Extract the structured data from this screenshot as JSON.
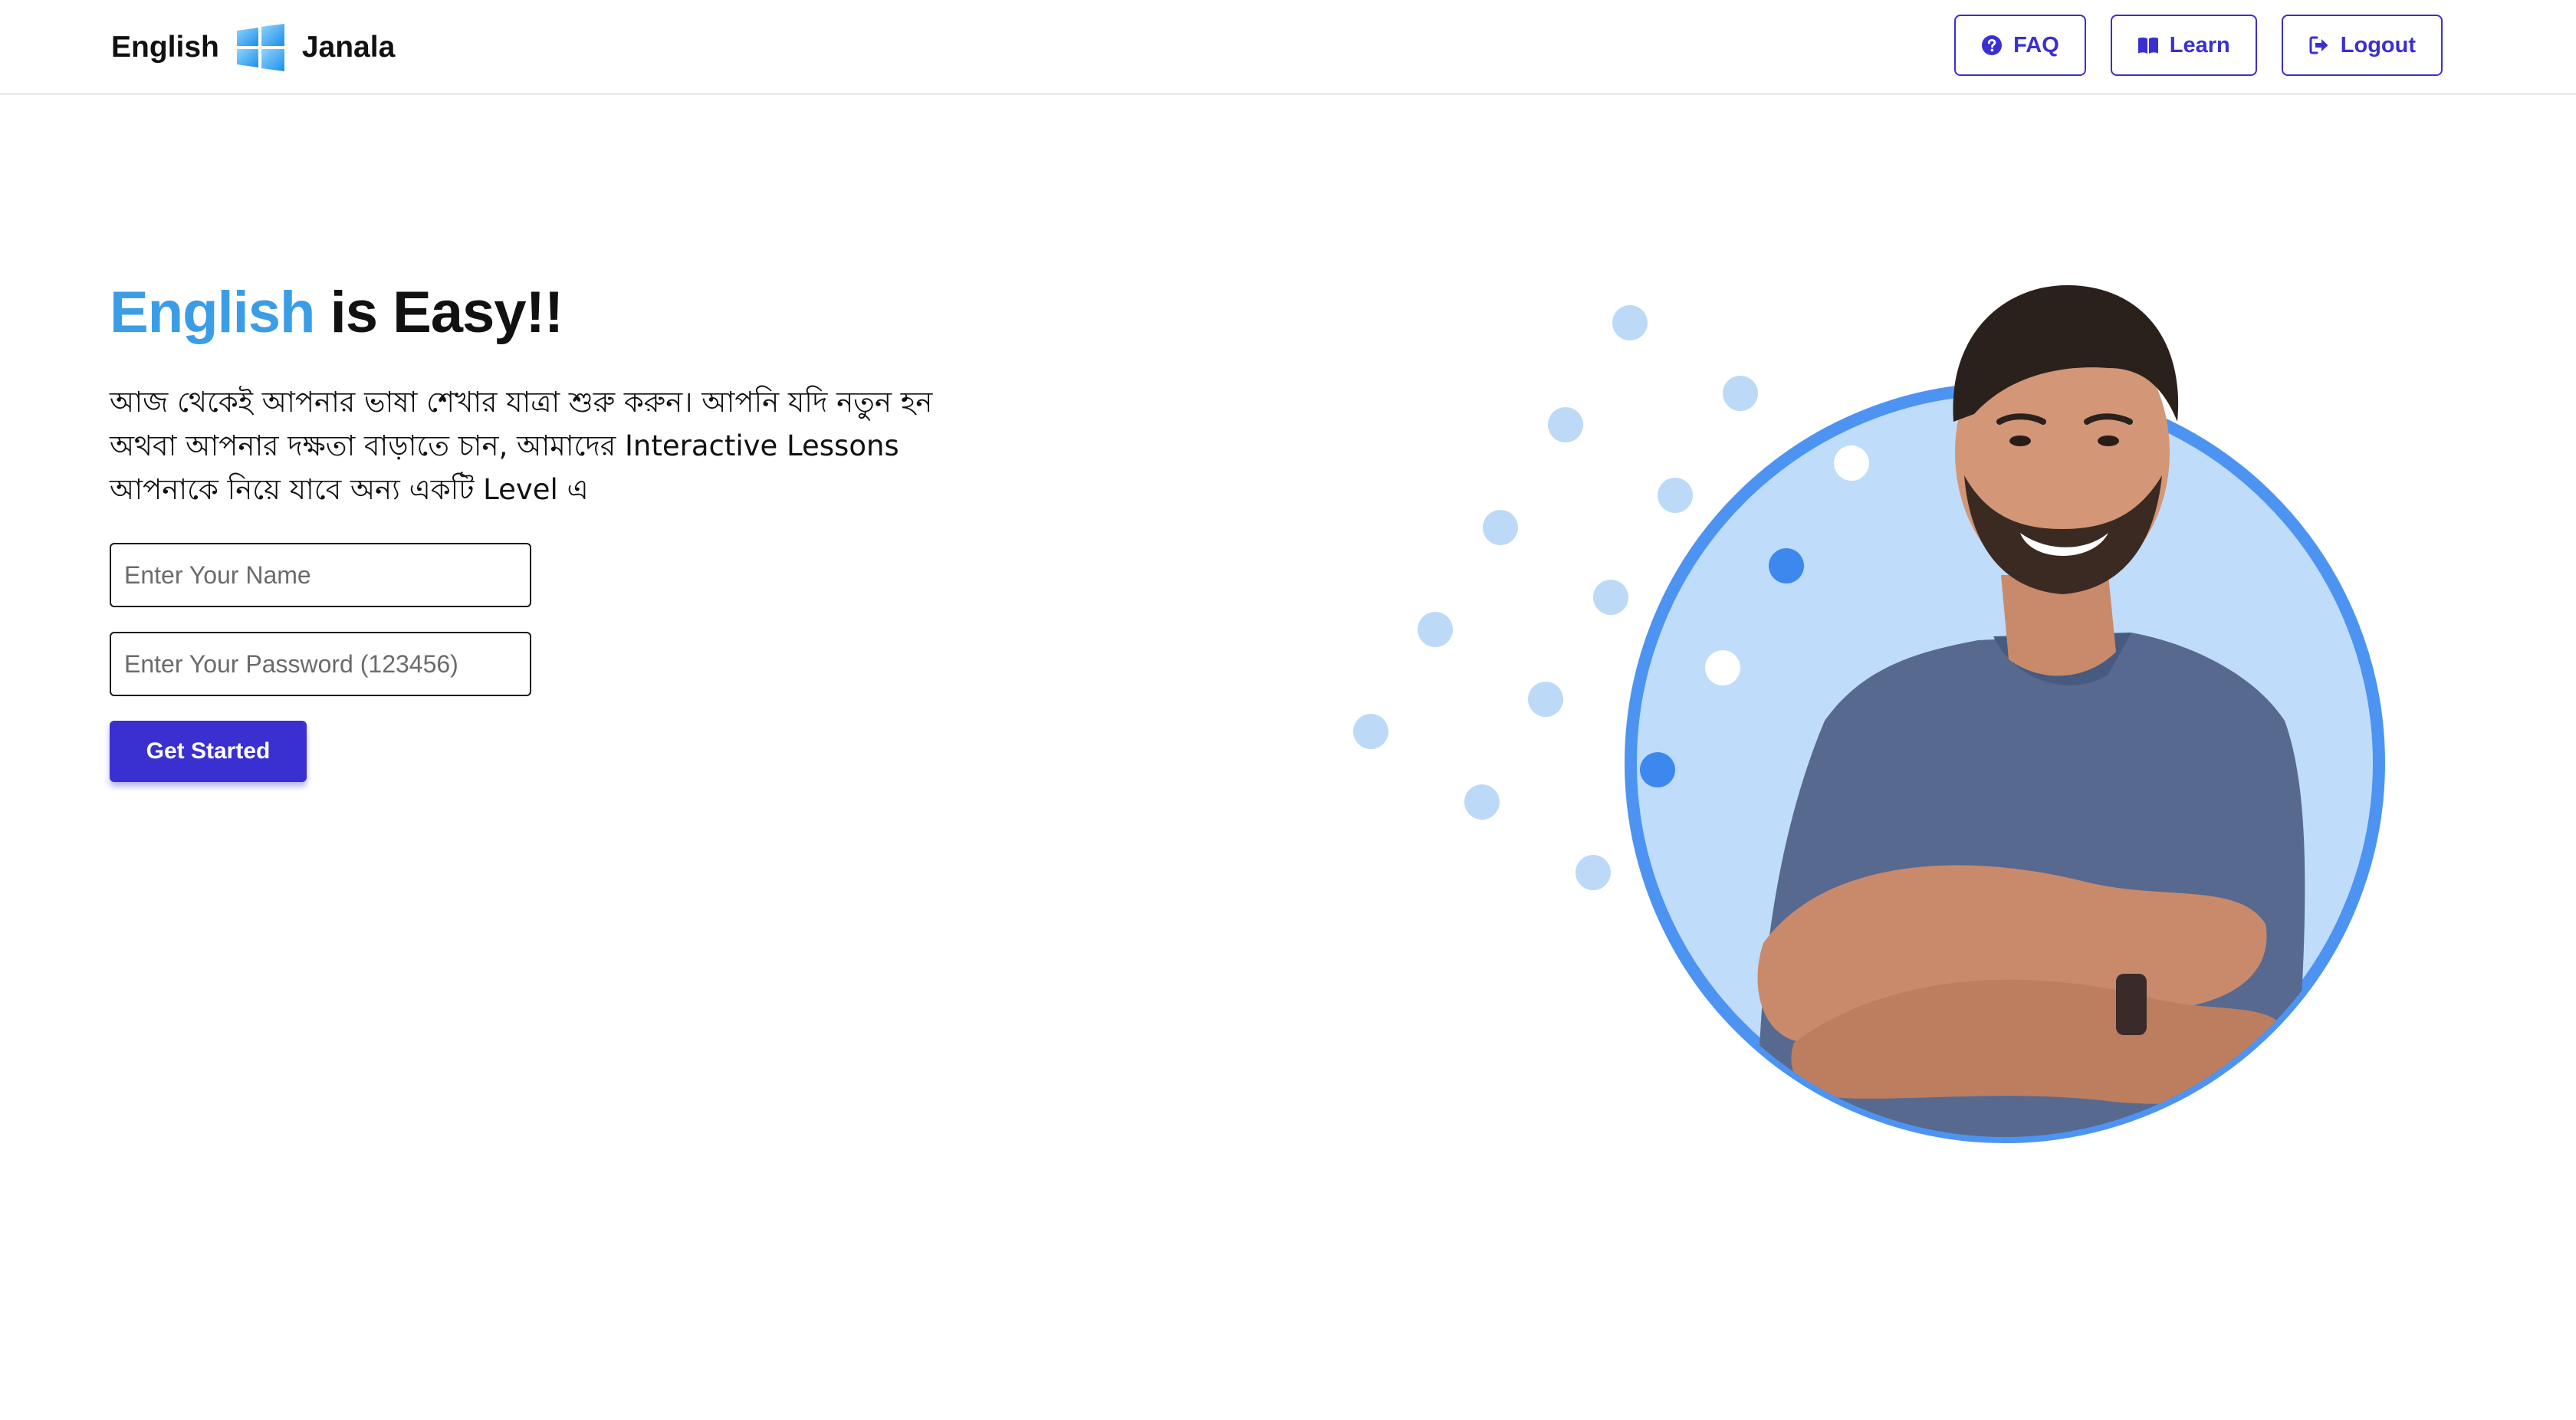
{
  "navbar": {
    "brand_left": "English",
    "brand_right": "Janala",
    "logo_icon": "windows-logo-icon",
    "buttons": [
      {
        "label": "FAQ",
        "icon": "question-circle-icon"
      },
      {
        "label": "Learn",
        "icon": "book-open-icon"
      },
      {
        "label": "Logout",
        "icon": "sign-out-icon"
      }
    ]
  },
  "hero": {
    "title_accent": "English",
    "title_rest": " is Easy!!",
    "description": "আজ থেকেই আপনার ভাষা শেখার যাত্রা শুরু করুন। আপনি যদি নতুন হন অথবা আপনার দক্ষতা বাড়াতে চান, আমাদের Interactive Lessons আপনাকে নিয়ে যাবে অন্য একটি Level এ",
    "name_placeholder": "Enter Your Name",
    "password_placeholder": "Enter Your Password (123456)",
    "cta_label": "Get Started"
  },
  "colors": {
    "accent_blue": "#3b9de6",
    "primary": "#3a2fd0",
    "ring": "#4d94f2",
    "circle_fill": "#bfdcfb",
    "dot_light": "#bcdaf8",
    "dot_dark": "#3d88ef"
  }
}
